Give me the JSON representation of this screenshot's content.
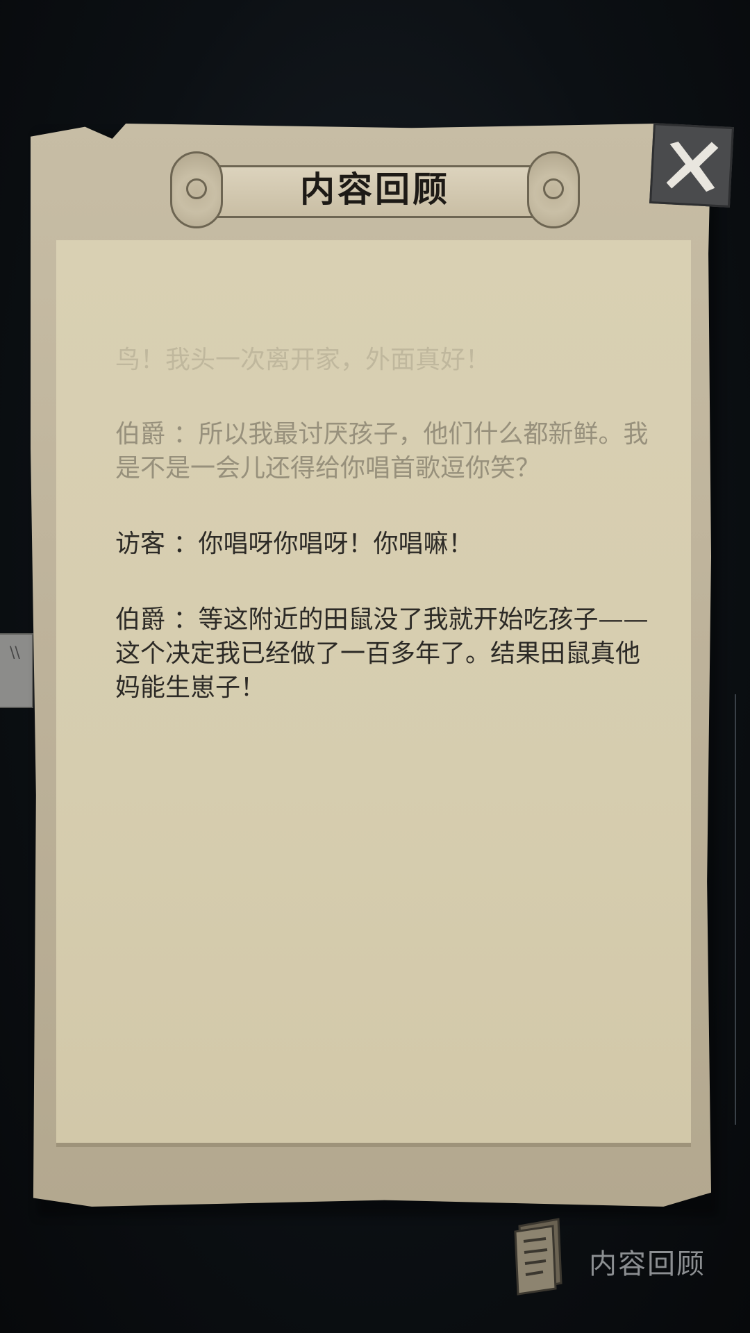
{
  "title": "内容回顾",
  "dialogue": [
    {
      "text": "鸟！我头一次离开家，外面真好！"
    },
    {
      "speaker": "伯爵",
      "sep": "：",
      "text": "所以我最讨厌孩子，他们什么都新鲜。我是不是一会儿还得给你唱首歌逗你笑？"
    },
    {
      "speaker": "访客",
      "sep": "：",
      "text": "你唱呀你唱呀！你唱嘛！"
    },
    {
      "speaker": "伯爵",
      "sep": "：",
      "text": "等这附近的田鼠没了我就开始吃孩子——这个决定我已经做了一百多年了。结果田鼠真他妈能生崽子！"
    }
  ],
  "review_button": {
    "label": "内容回顾"
  },
  "icons": {
    "close": "close-x-icon",
    "review": "scroll-document-icon"
  },
  "colors": {
    "paper": "#d8cfb2",
    "board": "#c0b59c",
    "text": "#2c2a26",
    "background": "#0c1014"
  }
}
